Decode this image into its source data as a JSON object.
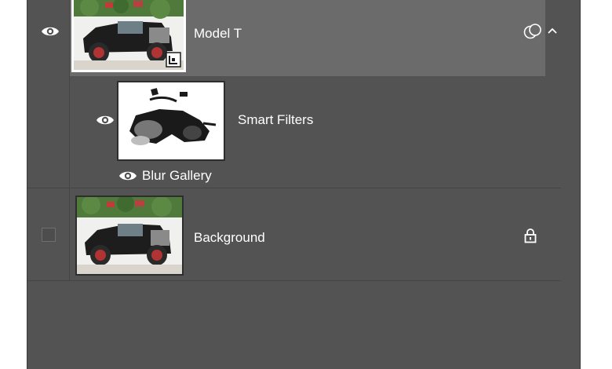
{
  "layers": {
    "model_t": {
      "name": "Model T"
    },
    "smart_filters": {
      "name": "Smart Filters"
    },
    "blur_gallery": {
      "name": "Blur Gallery"
    },
    "background": {
      "name": "Background"
    }
  },
  "icons": {
    "eye": "eye-icon",
    "link": "smart-object-link-icon",
    "collapse": "chevron-up-icon",
    "lock": "lock-icon"
  },
  "colors": {
    "panel": "#535353",
    "selected_row": "#6b6b6b",
    "text": "#ffffff"
  }
}
